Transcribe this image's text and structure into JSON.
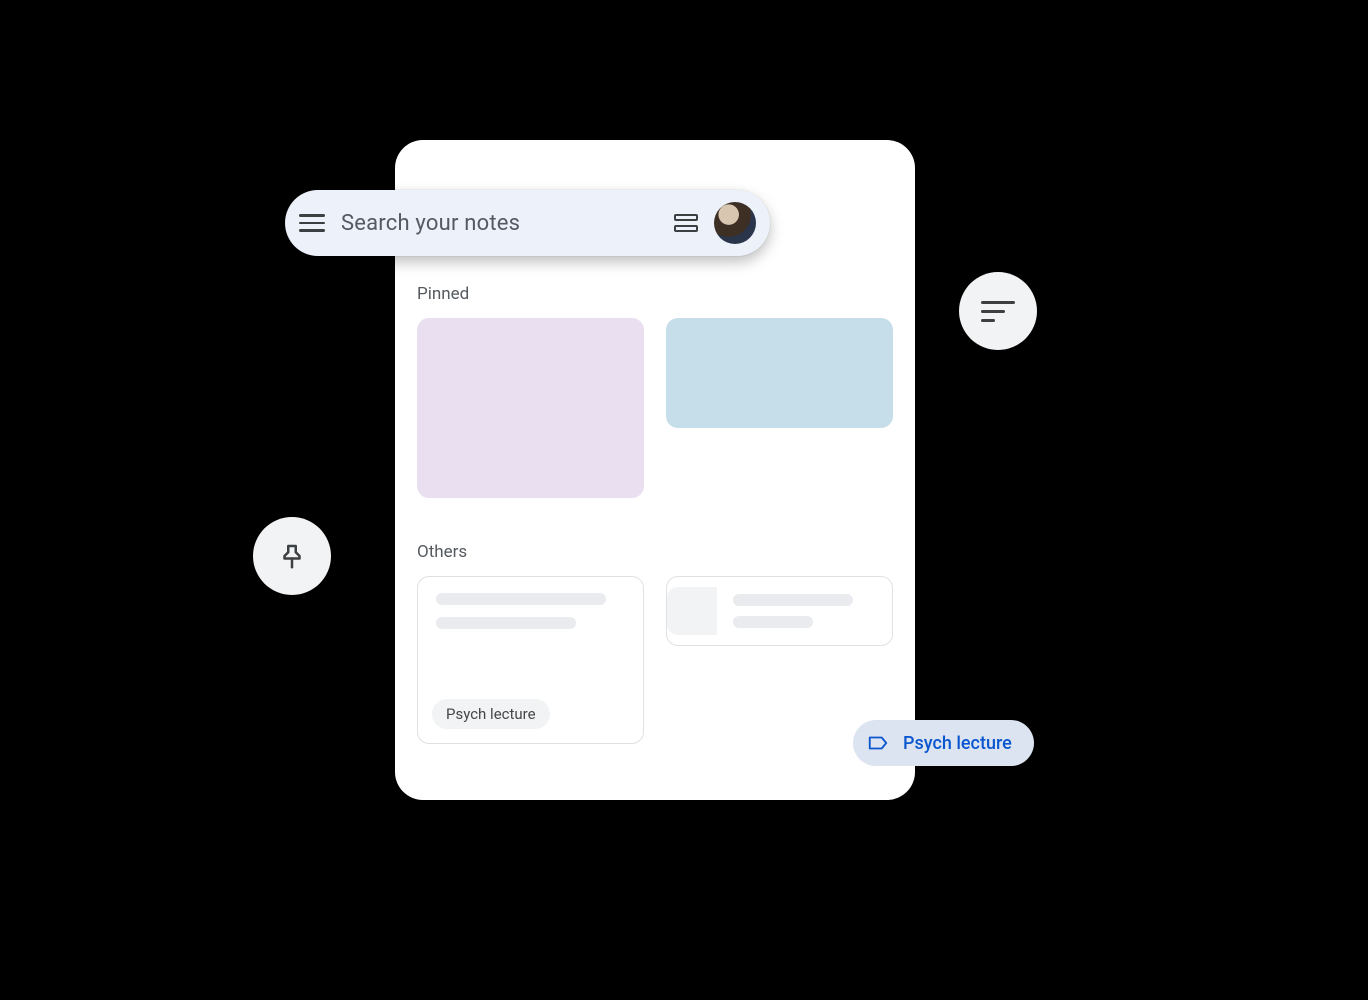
{
  "search": {
    "placeholder": "Search your notes"
  },
  "sections": {
    "pinned": "Pinned",
    "others": "Others"
  },
  "pinned": [
    {
      "color": "#e9dff0"
    },
    {
      "color": "#c6ddea"
    }
  ],
  "others": [
    {
      "chip": "Psych lecture"
    },
    {
      "thumbnail": true
    }
  ],
  "floating_label": {
    "text": "Psych lecture"
  }
}
